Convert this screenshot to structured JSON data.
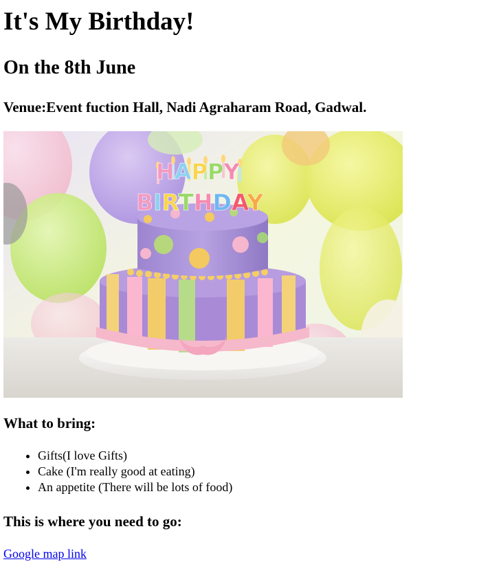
{
  "heading": "It's My Birthday!",
  "date_heading": "On the 8th June",
  "venue": "Venue:Event fuction Hall, Nadi Agraharam Road, Gadwal.",
  "image": {
    "description_icon": "birthday-cake-photo",
    "candle_text_line1": "HAPPY",
    "candle_text_line2": "BIRTHDAY"
  },
  "bring": {
    "title": "What to bring:",
    "items": [
      "Gifts(I love Gifts)",
      "Cake (I'm really good at eating)",
      "An appetite (There will be lots of food)"
    ]
  },
  "directions": {
    "title": "This is where you need to go:",
    "link_text": "Google map link"
  },
  "colors": {
    "link": "#0000ee",
    "text": "#000000",
    "background": "#ffffff"
  }
}
